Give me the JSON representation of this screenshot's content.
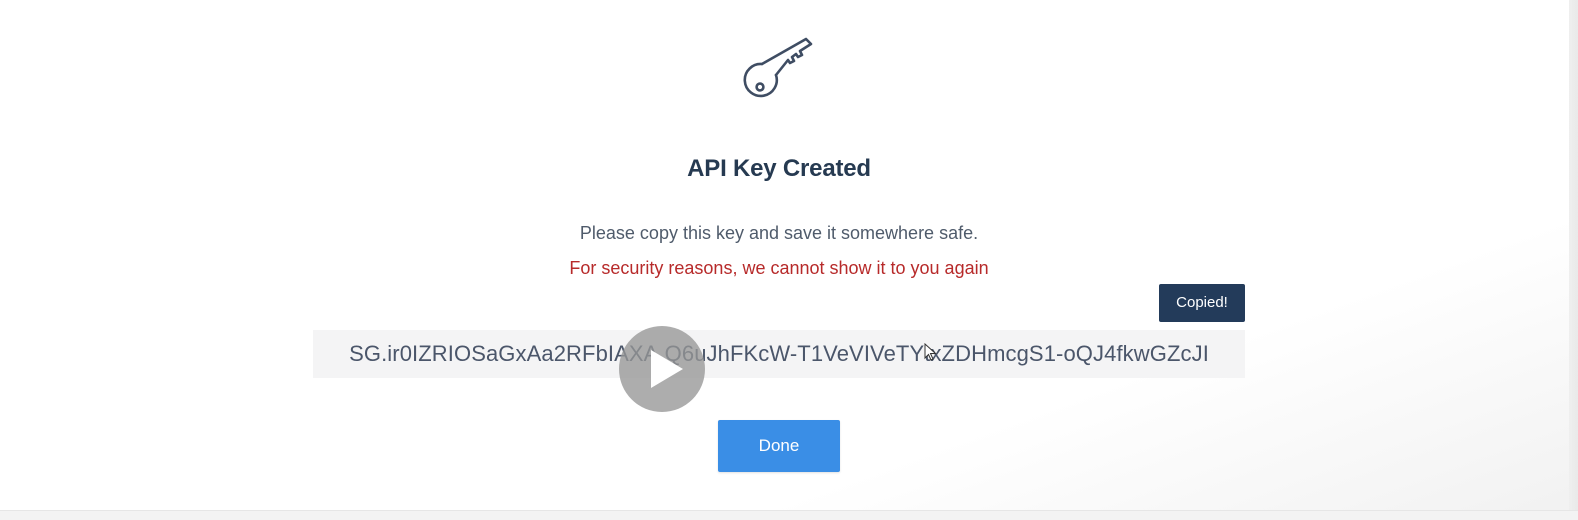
{
  "dialog": {
    "icon": "key-icon",
    "title": "API Key Created",
    "instructions": "Please copy this key and save it somewhere safe.",
    "warning": "For security reasons, we cannot show it to you again",
    "tooltip": "Copied!",
    "api_key": "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",
    "done_label": "Done"
  },
  "overlay": {
    "play_icon": "play-icon",
    "cursor_icon": "cursor-icon"
  },
  "colors": {
    "title": "#263a51",
    "warning": "#b72a2a",
    "tooltip_bg": "#233b5a",
    "primary_button": "#3a8ee6"
  }
}
